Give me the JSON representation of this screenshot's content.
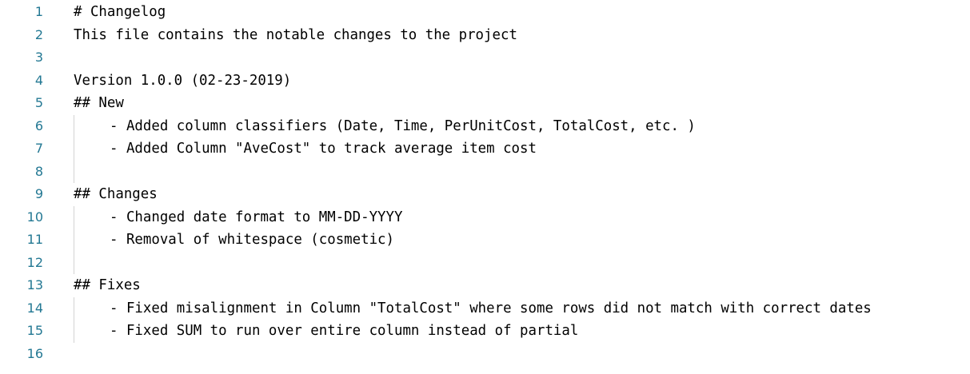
{
  "editor": {
    "lines": [
      {
        "num": "1",
        "text": "# Changelog"
      },
      {
        "num": "2",
        "text": "This file contains the notable changes to the project"
      },
      {
        "num": "3",
        "text": ""
      },
      {
        "num": "4",
        "text": "Version 1.0.0 (02-23-2019)"
      },
      {
        "num": "5",
        "text": "## New"
      },
      {
        "num": "6",
        "text": "- Added column classifiers (Date, Time, PerUnitCost, TotalCost, etc. )"
      },
      {
        "num": "7",
        "text": "- Added Column \"AveCost\" to track average item cost"
      },
      {
        "num": "8",
        "text": ""
      },
      {
        "num": "9",
        "text": "## Changes"
      },
      {
        "num": "10",
        "text": "- Changed date format to MM-DD-YYYY"
      },
      {
        "num": "11",
        "text": "- Removal of whitespace (cosmetic)"
      },
      {
        "num": "12",
        "text": ""
      },
      {
        "num": "13",
        "text": "## Fixes"
      },
      {
        "num": "14",
        "text": "- Fixed misalignment in Column \"TotalCost\" where some rows did not match with correct dates"
      },
      {
        "num": "15",
        "text": "- Fixed SUM to run over entire column instead of partial"
      },
      {
        "num": "16",
        "text": ""
      }
    ]
  },
  "colors": {
    "line_number": "#237893",
    "text": "#000000",
    "indent_guide": "#d3d3d3",
    "background": "#ffffff"
  }
}
